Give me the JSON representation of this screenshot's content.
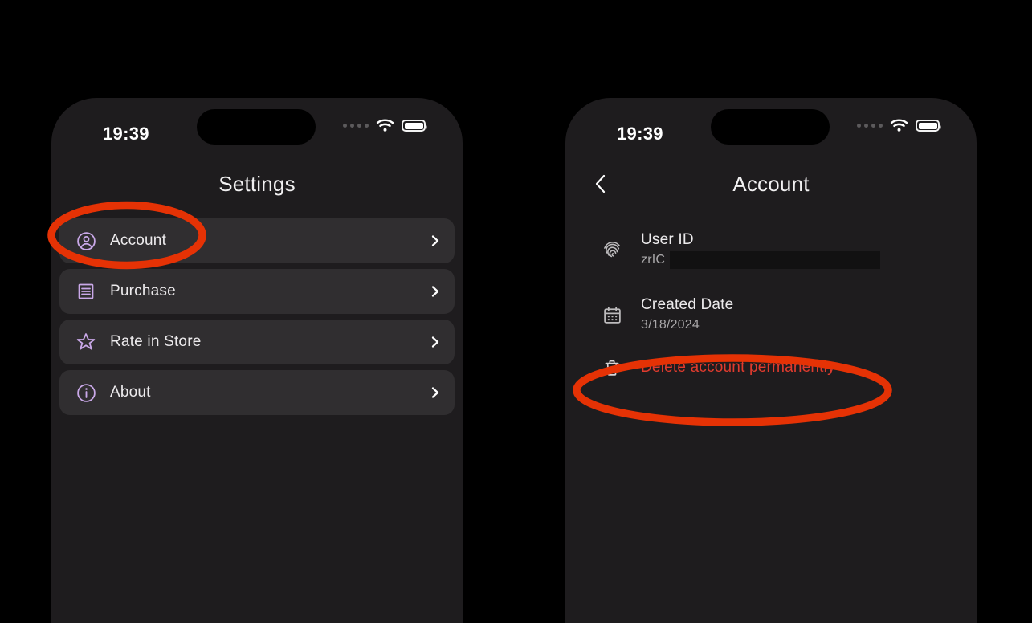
{
  "colors": {
    "canvas": "#000000",
    "screen_bg": "#1e1c1e",
    "card_bg": "#302e30",
    "accent_icon": "#c9a8e8",
    "danger_text": "#e03b2e",
    "annotation_red": "#e53205",
    "primary_text": "#eceaec",
    "secondary_text": "#a9a7a9"
  },
  "left_phone": {
    "status_bar": {
      "time": "19:39",
      "signal_icon": "cellular-dots-icon",
      "wifi_icon": "wifi-icon",
      "battery_icon": "battery-full-icon"
    },
    "nav": {
      "title": "Settings"
    },
    "list_items": [
      {
        "label": "Account",
        "icon": "person-circle-icon",
        "chevron": "chevron-right-icon"
      },
      {
        "label": "Purchase",
        "icon": "receipt-icon",
        "chevron": "chevron-right-icon"
      },
      {
        "label": "Rate in Store",
        "icon": "star-icon",
        "chevron": "chevron-right-icon"
      },
      {
        "label": "About",
        "icon": "info-circle-icon",
        "chevron": "chevron-right-icon"
      }
    ]
  },
  "right_phone": {
    "status_bar": {
      "time": "19:39",
      "signal_icon": "cellular-dots-icon",
      "wifi_icon": "wifi-icon",
      "battery_icon": "battery-full-icon"
    },
    "nav": {
      "title": "Account",
      "back_icon": "chevron-left-icon"
    },
    "detail_rows": [
      {
        "title": "User ID",
        "value": "zrIC",
        "icon": "fingerprint-icon",
        "redacted": true
      },
      {
        "title": "Created Date",
        "value": "3/18/2024",
        "icon": "calendar-icon",
        "redacted": false
      }
    ],
    "danger_action": {
      "label": "Delete account permanently",
      "icon": "trash-icon"
    }
  },
  "annotations": [
    {
      "name": "highlight-account-row",
      "shape": "ellipse"
    },
    {
      "name": "highlight-delete-action",
      "shape": "ellipse"
    }
  ]
}
